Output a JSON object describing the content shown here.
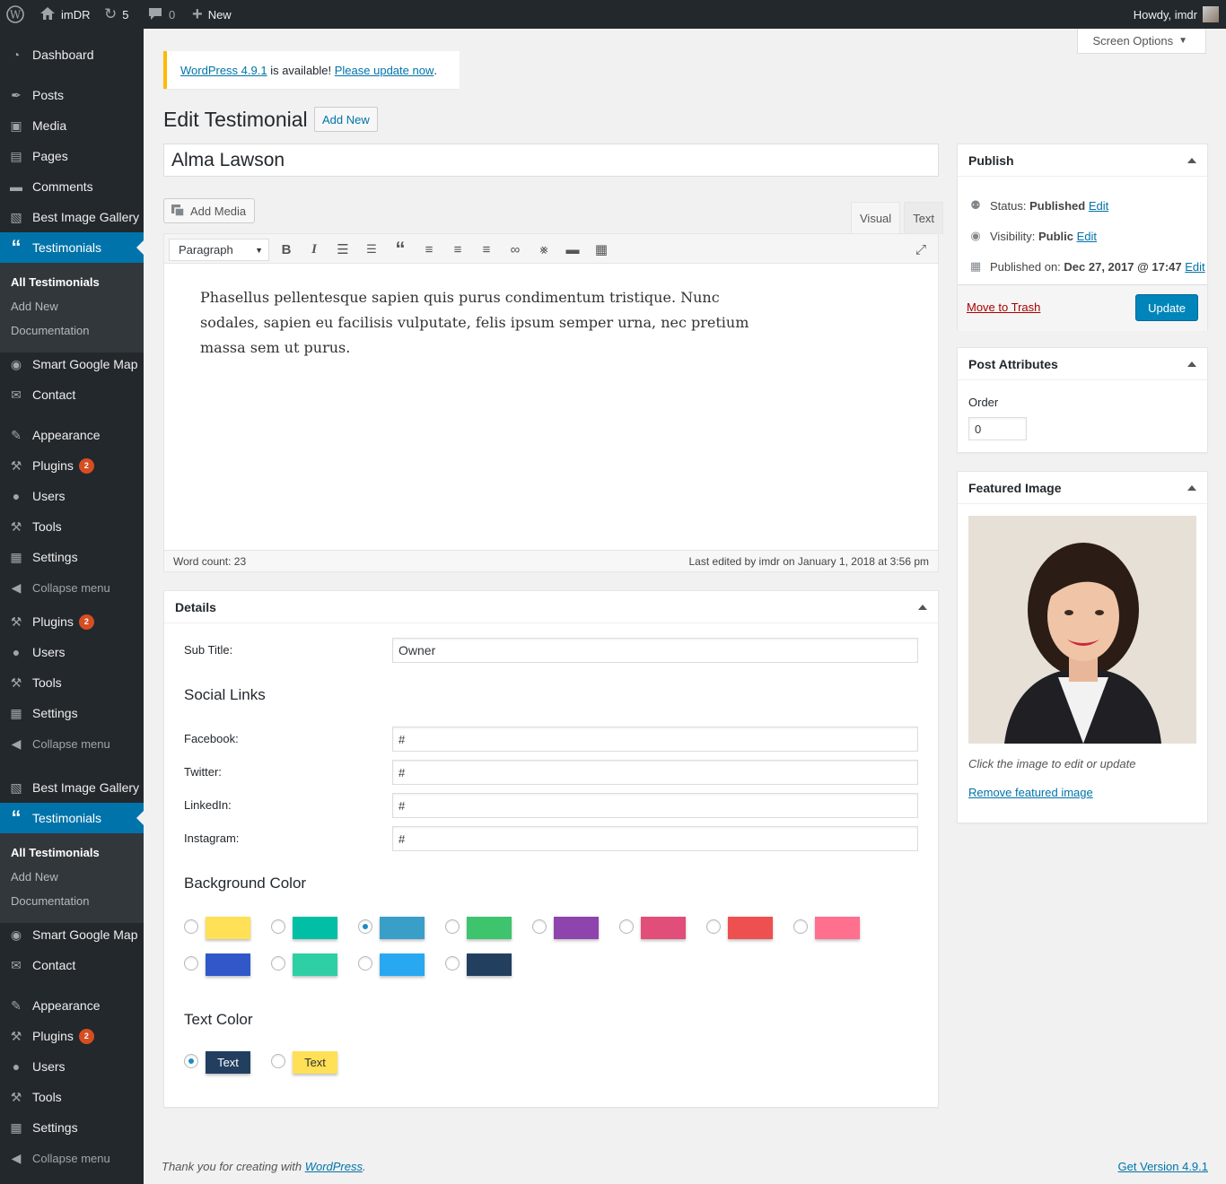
{
  "adminbar": {
    "site": "imDR",
    "updates": "5",
    "comments": "0",
    "new": "New",
    "howdy": "Howdy, imdr"
  },
  "menu": {
    "dashboard": "Dashboard",
    "posts": "Posts",
    "media": "Media",
    "pages": "Pages",
    "comments": "Comments",
    "gallery": "Best Image Gallery",
    "testimonials": "Testimonials",
    "sub": {
      "all": "All Testimonials",
      "addnew": "Add New",
      "docs": "Documentation"
    },
    "gmap": "Smart Google Map",
    "contact": "Contact",
    "appearance": "Appearance",
    "plugins": "Plugins",
    "plugins_badge": "2",
    "users": "Users",
    "tools": "Tools",
    "settings": "Settings",
    "collapse": "Collapse menu"
  },
  "screen_options": "Screen Options",
  "notice": {
    "link1": "WordPress 4.9.1",
    "text": " is available! ",
    "link2": "Please update now",
    "end": "."
  },
  "page_title": "Edit Testimonial",
  "add_new": "Add New",
  "post_title": "Alma Lawson",
  "editor": {
    "add_media": "Add Media",
    "tab_visual": "Visual",
    "tab_text": "Text",
    "format": "Paragraph",
    "content": "Phasellus pellentesque sapien quis purus condimentum tristique. Nunc sodales, sapien eu facilisis vulputate, felis ipsum semper urna, nec pretium massa sem ut purus.",
    "word_count": "Word count: 23",
    "last_edited": "Last edited by imdr on January 1, 2018 at 3:56 pm"
  },
  "details": {
    "title": "Details",
    "subtitle_label": "Sub Title:",
    "subtitle_value": "Owner",
    "social_heading": "Social Links",
    "facebook_label": "Facebook:",
    "facebook": "#",
    "twitter_label": "Twitter:",
    "twitter": "#",
    "linkedin_label": "LinkedIn:",
    "linkedin": "#",
    "instagram_label": "Instagram:",
    "instagram": "#",
    "bg_heading": "Background Color",
    "text_heading": "Text Color",
    "text_swatch_1": "Text",
    "text_swatch_2": "Text",
    "bg_colors": [
      "#ffe056",
      "#00bfa5",
      "#3a9fc8",
      "#3ec46d",
      "#8e44ad",
      "#e04e79",
      "#ee5050",
      "#ff6f8e",
      "#3158c9",
      "#2ecfa5",
      "#29a8f2",
      "#223f60"
    ],
    "bg_selected": "#3a9fc8",
    "text_colors": [
      "#223f60",
      "#ffe056"
    ]
  },
  "publish": {
    "title": "Publish",
    "status_label": "Status: ",
    "status": "Published",
    "visibility_label": "Visibility: ",
    "visibility": "Public",
    "published_label": "Published on: ",
    "published": "Dec 27, 2017 @ 17:47",
    "edit": "Edit",
    "trash": "Move to Trash",
    "update": "Update"
  },
  "attributes": {
    "title": "Post Attributes",
    "order_label": "Order",
    "order": "0"
  },
  "featured": {
    "title": "Featured Image",
    "hint": "Click the image to edit or update",
    "remove": "Remove featured image"
  },
  "footer": {
    "thanks": "Thank you for creating with ",
    "wp": "WordPress",
    "end": ".",
    "version": "Get Version 4.9.1"
  }
}
